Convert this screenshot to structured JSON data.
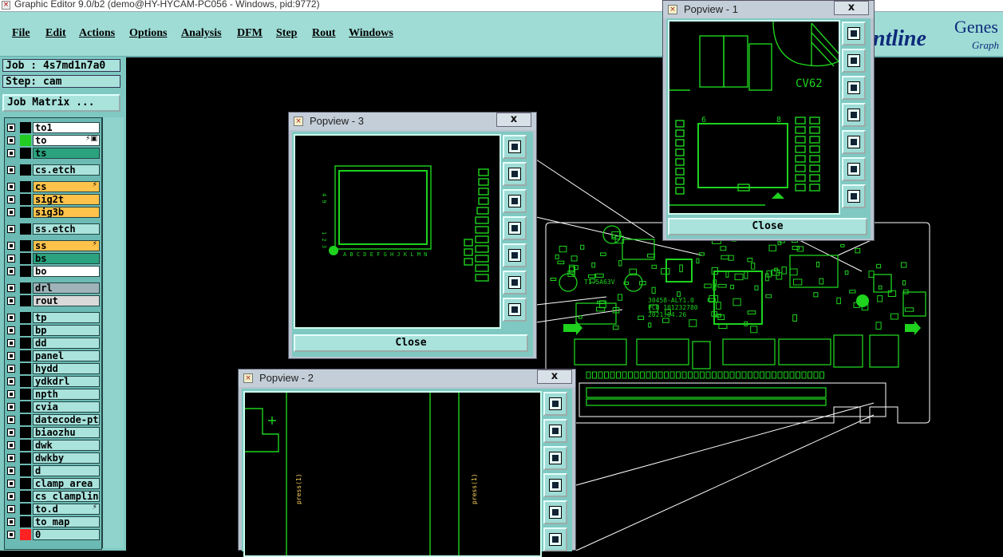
{
  "window": {
    "title": "Graphic Editor 9.0/b2 (demo@HY-HYCAM-PC056 - Windows, pid:9772)"
  },
  "menu": {
    "items": [
      "File",
      "Edit",
      "Actions",
      "Options",
      "Analysis",
      "DFM",
      "Step",
      "Rout",
      "Windows"
    ]
  },
  "logo": {
    "text": "ontline",
    "text2": "Genes",
    "text3": "Graph"
  },
  "job": {
    "label": "Job : 4s7md1n7a0",
    "step": "Step: cam",
    "matrix_button": "Job Matrix ..."
  },
  "layers": [
    {
      "name": "to1",
      "color": "#ffffff",
      "swatch": "#000000",
      "mark": ""
    },
    {
      "name": "to",
      "color": "#ffffff",
      "swatch": "#22cc22",
      "mark": "⚡▣"
    },
    {
      "name": "ts",
      "color": "#2aa37e",
      "swatch": "#000000",
      "mark": ""
    },
    {
      "name": "cs.etch",
      "color": "#a9e3dc",
      "swatch": "#000000",
      "mark": ""
    },
    {
      "name": "cs",
      "color": "#ffc24a",
      "swatch": "#000000",
      "mark": "⚡"
    },
    {
      "name": "sig2t",
      "color": "#ffc24a",
      "swatch": "#000000",
      "mark": ""
    },
    {
      "name": "sig3b",
      "color": "#ffc24a",
      "swatch": "#000000",
      "mark": ""
    },
    {
      "name": "ss.etch",
      "color": "#a9e3dc",
      "swatch": "#000000",
      "mark": ""
    },
    {
      "name": "ss",
      "color": "#ffc24a",
      "swatch": "#000000",
      "mark": "⚡"
    },
    {
      "name": "bs",
      "color": "#2aa37e",
      "swatch": "#000000",
      "mark": ""
    },
    {
      "name": "bo",
      "color": "#ffffff",
      "swatch": "#000000",
      "mark": ""
    },
    {
      "name": "drl",
      "color": "#9fb3b8",
      "swatch": "#000000",
      "mark": ""
    },
    {
      "name": "rout",
      "color": "#d9d9d9",
      "swatch": "#000000",
      "mark": ""
    },
    {
      "name": "tp",
      "color": "#a9e3dc",
      "swatch": "#000000",
      "mark": ""
    },
    {
      "name": "bp",
      "color": "#a9e3dc",
      "swatch": "#000000",
      "mark": ""
    },
    {
      "name": "dd",
      "color": "#a9e3dc",
      "swatch": "#000000",
      "mark": ""
    },
    {
      "name": "panel",
      "color": "#a9e3dc",
      "swatch": "#000000",
      "mark": ""
    },
    {
      "name": "hydd",
      "color": "#a9e3dc",
      "swatch": "#000000",
      "mark": ""
    },
    {
      "name": "ydkdrl",
      "color": "#a9e3dc",
      "swatch": "#000000",
      "mark": ""
    },
    {
      "name": "npth",
      "color": "#a9e3dc",
      "swatch": "#000000",
      "mark": ""
    },
    {
      "name": "cvia",
      "color": "#a9e3dc",
      "swatch": "#000000",
      "mark": ""
    },
    {
      "name": "datecode-pto",
      "color": "#a9e3dc",
      "swatch": "#000000",
      "mark": ""
    },
    {
      "name": "biaozhu",
      "color": "#a9e3dc",
      "swatch": "#000000",
      "mark": ""
    },
    {
      "name": "dwk",
      "color": "#a9e3dc",
      "swatch": "#000000",
      "mark": ""
    },
    {
      "name": "dwkby",
      "color": "#a9e3dc",
      "swatch": "#000000",
      "mark": ""
    },
    {
      "name": "d",
      "color": "#a9e3dc",
      "swatch": "#000000",
      "mark": ""
    },
    {
      "name": "clamp_area",
      "color": "#a9e3dc",
      "swatch": "#000000",
      "mark": ""
    },
    {
      "name": "cs_clamplines",
      "color": "#a9e3dc",
      "swatch": "#000000",
      "mark": ""
    },
    {
      "name": "to.d",
      "color": "#a9e3dc",
      "swatch": "#000000",
      "mark": "⚡"
    },
    {
      "name": "to_map",
      "color": "#a9e3dc",
      "swatch": "#000000",
      "mark": ""
    },
    {
      "name": "0",
      "color": "#a9e3dc",
      "swatch": "#ff2222",
      "mark": ""
    }
  ],
  "popviews": {
    "p1": {
      "title": "Popview - 1",
      "close_x": "x",
      "close_label": "Close",
      "board_text": "CV62",
      "pin_a": "6",
      "pin_b": "8"
    },
    "p2": {
      "title": "Popview - 2",
      "close_x": "x",
      "text_a": "press(1)",
      "text_b": "press(1)"
    },
    "p3": {
      "title": "Popview - 3",
      "close_x": "x",
      "close_label": "Close",
      "pin_top": "4 9",
      "pin_mid": "1 2 3",
      "pin_bottom": "A B C D E F G H J K L M N"
    }
  },
  "board": {
    "label1": "T1.5A63V",
    "label2": "30458-ALY1.0",
    "label3": "PCB 101232780",
    "label4": "2021.04.26"
  }
}
